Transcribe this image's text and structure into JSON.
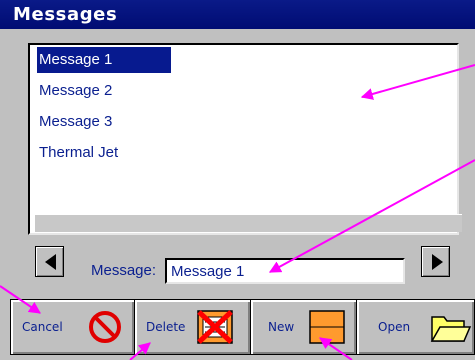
{
  "window": {
    "title": "Messages"
  },
  "list": {
    "items": [
      "Message 1",
      "Message 2",
      "Message 3",
      "Thermal Jet"
    ],
    "selected_index": 0
  },
  "message_field": {
    "label": "Message:",
    "value": "Message 1"
  },
  "buttons": {
    "cancel": "Cancel",
    "delete": "Delete",
    "new": "New",
    "open": "Open"
  },
  "icons": {
    "prev": "left-arrow-icon",
    "next": "right-arrow-icon",
    "cancel": "prohibited-icon",
    "delete": "delete-message-icon",
    "new": "new-message-icon",
    "open": "folder-open-icon"
  },
  "colors": {
    "titlebar": "#000c73",
    "selection": "#071a8f",
    "annotation": "#ff00ff",
    "text": "#0a1f8f"
  }
}
